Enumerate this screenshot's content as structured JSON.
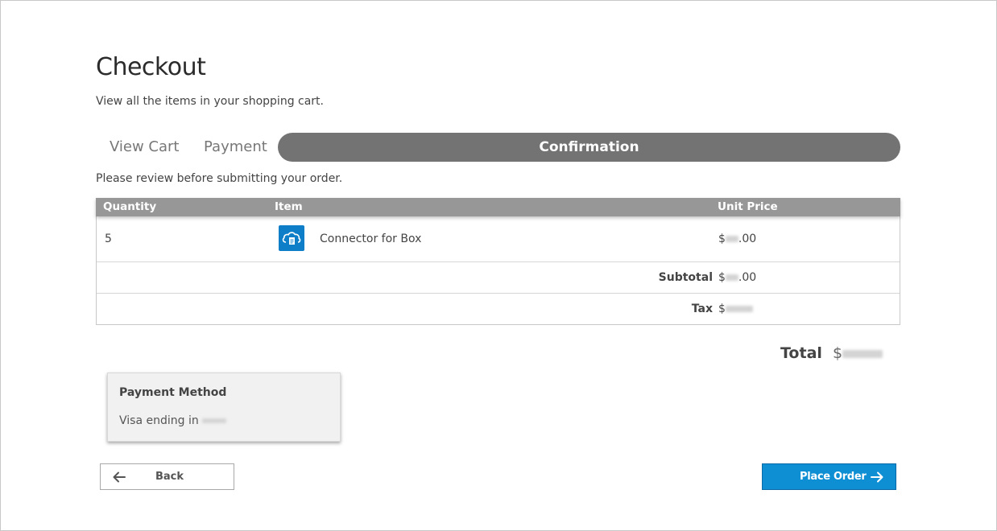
{
  "page": {
    "title": "Checkout",
    "subtitle": "View all the items in your shopping cart."
  },
  "steps": [
    {
      "label": "View Cart",
      "active": false
    },
    {
      "label": "Payment",
      "active": false
    },
    {
      "label": "Confirmation",
      "active": true
    }
  ],
  "review_text": "Please review before submitting your order.",
  "table": {
    "headers": {
      "quantity": "Quantity",
      "item": "Item",
      "unit_price": "Unit Price"
    },
    "rows": [
      {
        "quantity": "5",
        "item": "Connector for Box",
        "icon": "cloud-document-icon",
        "unit_price_prefix": "$",
        "unit_price_suffix": ".00"
      }
    ],
    "subtotal": {
      "label": "Subtotal",
      "value_prefix": "$",
      "value_suffix": ".00"
    },
    "tax": {
      "label": "Tax",
      "value_prefix": "$"
    }
  },
  "total": {
    "label": "Total",
    "value_prefix": "$"
  },
  "payment_method": {
    "title": "Payment Method",
    "detail": "Visa ending in"
  },
  "buttons": {
    "back": "Back",
    "place_order": "Place Order"
  },
  "colors": {
    "active_step": "#737373",
    "table_header": "#979797",
    "primary_button": "#0e8ed3",
    "item_icon": "#0e7ec8"
  }
}
